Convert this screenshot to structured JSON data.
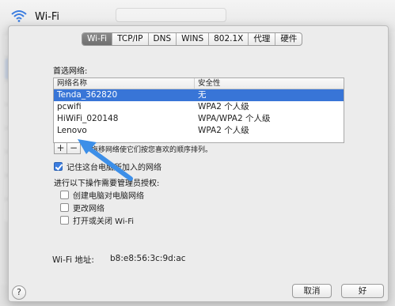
{
  "window": {
    "title": "Wi-Fi"
  },
  "tabs": [
    {
      "label": "Wi-Fi",
      "active": true
    },
    {
      "label": "TCP/IP",
      "active": false
    },
    {
      "label": "DNS",
      "active": false
    },
    {
      "label": "WINS",
      "active": false
    },
    {
      "label": "802.1X",
      "active": false
    },
    {
      "label": "代理",
      "active": false
    },
    {
      "label": "硬件",
      "active": false
    }
  ],
  "preferred": {
    "section_label": "首选网络:",
    "columns": [
      "网络名称",
      "安全性"
    ],
    "rows": [
      {
        "name": "Tenda_362820",
        "security": "无",
        "selected": true
      },
      {
        "name": "pcwifi",
        "security": "WPA2 个人级",
        "selected": false
      },
      {
        "name": "HiWiFi_020148",
        "security": "WPA/WPA2 个人级",
        "selected": false
      },
      {
        "name": "Lenovo",
        "security": "WPA2 个人级",
        "selected": false
      }
    ]
  },
  "list_buttons": {
    "add": "+",
    "remove": "−",
    "drag_hint": "拖移网络使它们按您喜欢的顺序排列。"
  },
  "remember": {
    "label": "记住这台电脑所加入的网络",
    "checked": true
  },
  "admin": {
    "label": "进行以下操作需要管理员授权:",
    "options": [
      {
        "label": "创建电脑对电脑网络",
        "checked": false
      },
      {
        "label": "更改网络",
        "checked": false
      },
      {
        "label": "打开或关闭 Wi-Fi",
        "checked": false
      }
    ]
  },
  "address": {
    "label": "Wi-Fi 地址:",
    "value": "b8:e8:56:3c:9d:ac"
  },
  "footer": {
    "help": "?",
    "cancel": "取消",
    "ok": "好"
  },
  "colors": {
    "selection": "#3875d7",
    "annotation_arrow": "#3d8fe8"
  }
}
